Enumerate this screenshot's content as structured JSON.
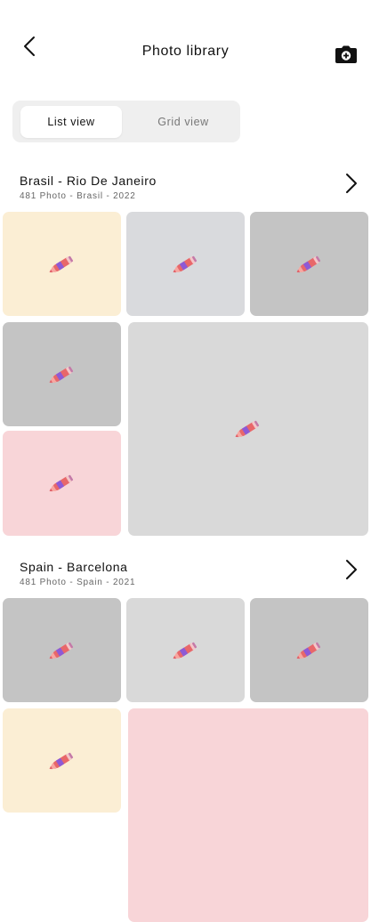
{
  "header": {
    "title": "Photo library",
    "back_icon": "chevron-left-icon",
    "camera_icon": "camera-plus-icon"
  },
  "view_toggle": {
    "list_label": "List view",
    "grid_label": "Grid view",
    "selected": "List view"
  },
  "albums": [
    {
      "title": "Brasil - Rio De Janeiro",
      "meta": "481 Photo - Brasil - 2022",
      "photo_colors": [
        "#fbeed4",
        "#d9dadd",
        "#c4c4c4",
        "#c4c4c4",
        "#d9d9d9",
        "#f8d5d8"
      ]
    },
    {
      "title": "Spain - Barcelona",
      "meta": "481 Photo - Spain - 2021",
      "photo_colors": [
        "#c4c4c4",
        "#d9d9d9",
        "#c4c4c4",
        "#fbeed4",
        "#f8d5d8"
      ]
    }
  ],
  "placeholder_icon": "pencil-icon",
  "colors": {
    "accent_pencil": "#e8676a",
    "toggle_bg": "#efefef"
  }
}
